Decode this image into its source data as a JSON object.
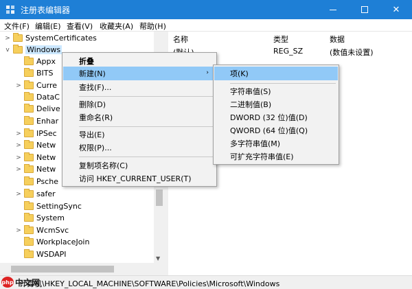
{
  "window": {
    "title": "注册表编辑器",
    "controls": [
      "—",
      "☐",
      "✕"
    ]
  },
  "menubar": [
    "文件(F)",
    "编辑(E)",
    "查看(V)",
    "收藏夹(A)",
    "帮助(H)"
  ],
  "tree": {
    "nodes": [
      {
        "label": "SystemCertificates",
        "expander": ">"
      },
      {
        "label": "Windows",
        "expander": "v",
        "selected": true
      },
      {
        "label": "Appx",
        "expander": ""
      },
      {
        "label": "BITS",
        "expander": ""
      },
      {
        "label": "Curre",
        "expander": ">"
      },
      {
        "label": "DataC",
        "expander": ""
      },
      {
        "label": "Delive",
        "expander": ""
      },
      {
        "label": "Enhar",
        "expander": ""
      },
      {
        "label": "IPSec",
        "expander": ">"
      },
      {
        "label": "Netw",
        "expander": ">"
      },
      {
        "label": "Netw",
        "expander": ">"
      },
      {
        "label": "Netw",
        "expander": ">"
      },
      {
        "label": "Psche",
        "expander": ""
      },
      {
        "label": "safer",
        "expander": ">"
      },
      {
        "label": "SettingSync",
        "expander": ""
      },
      {
        "label": "System",
        "expander": ""
      },
      {
        "label": "WcmSvc",
        "expander": ">"
      },
      {
        "label": "WorkplaceJoin",
        "expander": ""
      },
      {
        "label": "WSDAPI",
        "expander": ""
      }
    ]
  },
  "list": {
    "columns": [
      "名称",
      "类型",
      "数据"
    ],
    "rows": [
      {
        "name": "(默认)",
        "type": "REG_SZ",
        "data": "(数值未设置)"
      }
    ]
  },
  "context_menu": {
    "items": [
      "折叠",
      "新建(N)",
      "查找(F)...",
      "删除(D)",
      "重命名(R)",
      "导出(E)",
      "权限(P)...",
      "复制项名称(C)",
      "访问 HKEY_CURRENT_USER(T)"
    ],
    "submenu_arrow": "›"
  },
  "submenu": {
    "items": [
      "项(K)",
      "字符串值(S)",
      "二进制值(B)",
      "DWORD (32 位)值(D)",
      "QWORD (64 位)值(Q)",
      "多字符串值(M)",
      "可扩充字符串值(E)"
    ]
  },
  "statusbar": {
    "path": "计算机\\HKEY_LOCAL_MACHINE\\SOFTWARE\\Policies\\Microsoft\\Windows"
  },
  "watermark": {
    "left_logo": "php",
    "left_text": "中文网"
  },
  "colors": {
    "titlebar": "#1e7fd6",
    "selection": "#cce8ff",
    "menu_highlight": "#91c9f7",
    "folder": "#f6cf5c"
  }
}
